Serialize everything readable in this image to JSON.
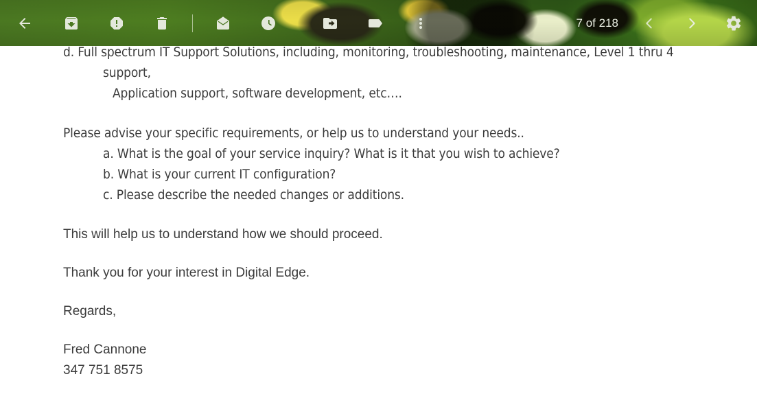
{
  "app": {
    "name": "Gmail Message View",
    "accent_color": "#4c7a22",
    "text_color": "#3b3b3b",
    "icon_color": "#e4e8dc"
  },
  "toolbar": {
    "actions": [
      {
        "name": "back-to-inbox",
        "label": "Back",
        "icon": "arrow-left-icon"
      },
      {
        "name": "archive",
        "label": "Archive",
        "icon": "archive-icon"
      },
      {
        "name": "report-spam",
        "label": "Report spam",
        "icon": "report-spam-icon"
      },
      {
        "name": "delete",
        "label": "Delete",
        "icon": "trash-icon"
      },
      {
        "name": "mark-unread",
        "label": "Mark as unread",
        "icon": "mail-open-icon"
      },
      {
        "name": "snooze",
        "label": "Snooze",
        "icon": "clock-icon"
      },
      {
        "name": "move-to",
        "label": "Move to",
        "icon": "move-to-folder-icon"
      },
      {
        "name": "labels",
        "label": "Labels",
        "icon": "label-tag-icon"
      },
      {
        "name": "more-options",
        "label": "More",
        "icon": "more-vertical-icon"
      }
    ],
    "counter": "7 of 218",
    "prev_label": "Older",
    "next_label": "Newer",
    "settings_label": "Settings",
    "prev_icon": "chevron-left-icon",
    "next_icon": "chevron-right-icon",
    "settings_icon": "gear-icon"
  },
  "message": {
    "lines": {
      "bullet_d": "d. Full spectrum IT Support Solutions, including, monitoring, troubleshooting, maintenance, Level 1 thru 4",
      "bullet_d_cont": "support,",
      "bullet_d_sub": "Application support, software development, etc….",
      "advise": "Please advise your specific requirements, or help us to understand your needs..",
      "item_a": "a. What is the goal of your service inquiry? What is it that you wish to achieve?",
      "item_b": "b. What is your current IT configuration?",
      "item_c": "c. Please describe the needed changes or additions.",
      "help": "This will help us to understand how we should proceed.",
      "thanks": "Thank you for your interest in Digital Edge.",
      "signoff": "Regards,",
      "sender_name": "Fred Cannone",
      "sender_phone": "347 751 8575"
    }
  }
}
